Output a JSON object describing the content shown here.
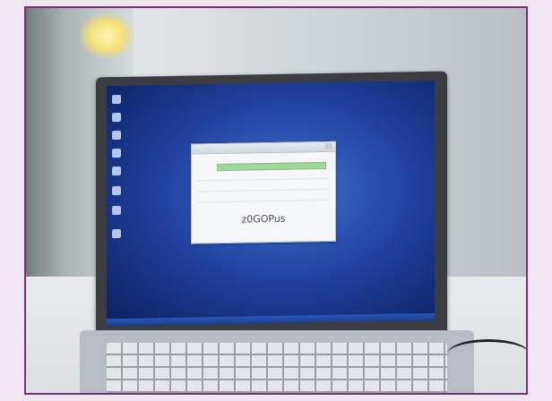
{
  "dialog": {
    "caption": "z0GOPus"
  },
  "colors": {
    "frame_border": "#7a2f7e",
    "frame_background": "#efe6f1",
    "screen_blue": "#1d3d98",
    "progress_green": "#9fd89a"
  },
  "icons": [
    "desktop-icon",
    "window-close-icon"
  ]
}
